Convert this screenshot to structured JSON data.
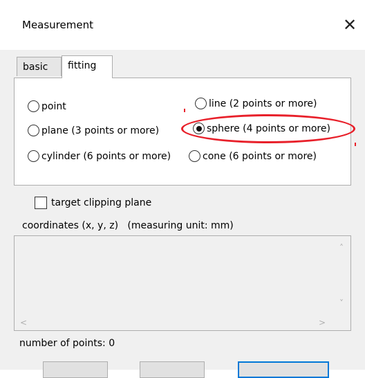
{
  "window": {
    "title": "Measurement",
    "close_glyph": "✕"
  },
  "tabs": [
    {
      "label": "basic",
      "active": false
    },
    {
      "label": "fitting",
      "active": true
    }
  ],
  "fitting": {
    "options": [
      {
        "label": "point",
        "checked": false
      },
      {
        "label": "line (2 points or more)",
        "checked": false
      },
      {
        "label": "plane (3 points or more)",
        "checked": false
      },
      {
        "label": "sphere (4 points or more)",
        "checked": true
      },
      {
        "label": "cylinder (6 points or more)",
        "checked": false
      },
      {
        "label": "cone (6 points or more)",
        "checked": false
      }
    ],
    "highlight_color": "#e8202a"
  },
  "target_clipping_plane": {
    "label": "target clipping plane",
    "checked": false
  },
  "coordinates": {
    "label": "coordinates (x, y, z)   (measuring unit: mm)",
    "value": ""
  },
  "status": {
    "points": "number of points: 0"
  },
  "icons": {
    "scroll_up": "˄",
    "scroll_down": "˅",
    "scroll_left": "<",
    "scroll_right": ">"
  }
}
